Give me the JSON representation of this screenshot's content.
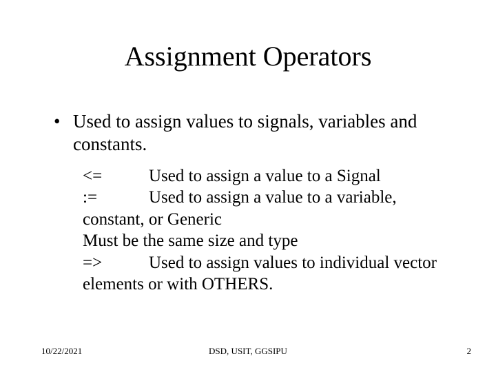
{
  "title": "Assignment Operators",
  "bullet": "Used to assign values to signals, variables and constants.",
  "operators": {
    "op1_sym": "<=",
    "op1_desc": "Used to assign a value to a Signal",
    "op2_sym": ":=",
    "op2_desc": "Used to assign a value to a variable, constant, or Generic",
    "note": "Must be the same size and type",
    "op3_sym": "=>",
    "op3_desc": "Used to assign values to individual vector elements or with OTHERS."
  },
  "footer": {
    "date": "10/22/2021",
    "center": "DSD, USIT, GGSIPU",
    "page": "2"
  }
}
